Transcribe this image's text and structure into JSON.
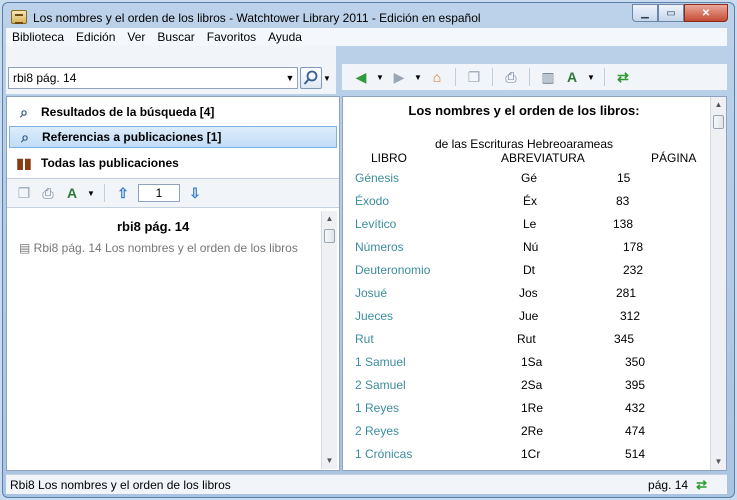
{
  "window": {
    "title": "Los nombres y el orden de los libros - Watchtower Library 2011 - Edición en español"
  },
  "menu": [
    "Biblioteca",
    "Edición",
    "Ver",
    "Buscar",
    "Favoritos",
    "Ayuda"
  ],
  "address": {
    "value": "rbi8 pág. 14"
  },
  "nav": {
    "items": [
      {
        "label": "Resultados de la búsqueda [4]",
        "icon": "search-icon"
      },
      {
        "label": "Referencias a publicaciones [1]",
        "icon": "search-icon"
      },
      {
        "label": "Todas las publicaciones",
        "icon": "books-icon"
      }
    ],
    "page_value": "1"
  },
  "result": {
    "title": "rbi8 pág. 14",
    "text": "Rbi8 pág. 14 Los nombres y el orden de los libros"
  },
  "doc": {
    "title": "Los nombres y el orden de los libros:",
    "subtitle": "de las Escrituras Hebreoarameas",
    "headers": {
      "book": "LIBRO",
      "abbr": "ABREVIATURA",
      "page": "PÁGINA"
    },
    "books": [
      {
        "name": "Génesis",
        "abbr": "Gé",
        "page": "15"
      },
      {
        "name": "Éxodo",
        "abbr": "Éx",
        "page": "83"
      },
      {
        "name": "Levítico",
        "abbr": "Le",
        "page": "138"
      },
      {
        "name": "Números",
        "abbr": "Nú",
        "page": "178"
      },
      {
        "name": "Deuteronomio",
        "abbr": "Dt",
        "page": "232"
      },
      {
        "name": "Josué",
        "abbr": "Jos",
        "page": "281"
      },
      {
        "name": "Jueces",
        "abbr": "Jue",
        "page": "312"
      },
      {
        "name": "Rut",
        "abbr": "Rut",
        "page": "345"
      },
      {
        "name": "1 Samuel",
        "abbr": "1Sa",
        "page": "350"
      },
      {
        "name": "2 Samuel",
        "abbr": "2Sa",
        "page": "395"
      },
      {
        "name": "1 Reyes",
        "abbr": "1Re",
        "page": "432"
      },
      {
        "name": "2 Reyes",
        "abbr": "2Re",
        "page": "474"
      },
      {
        "name": "1 Crónicas",
        "abbr": "1Cr",
        "page": "514"
      }
    ]
  },
  "status": {
    "text": "Rbi8 Los nombres y el orden de los libros",
    "page": "pág. 14"
  },
  "colors": {
    "book_link": "#3c8d9e",
    "selected_bg": "#c2ddf7"
  }
}
